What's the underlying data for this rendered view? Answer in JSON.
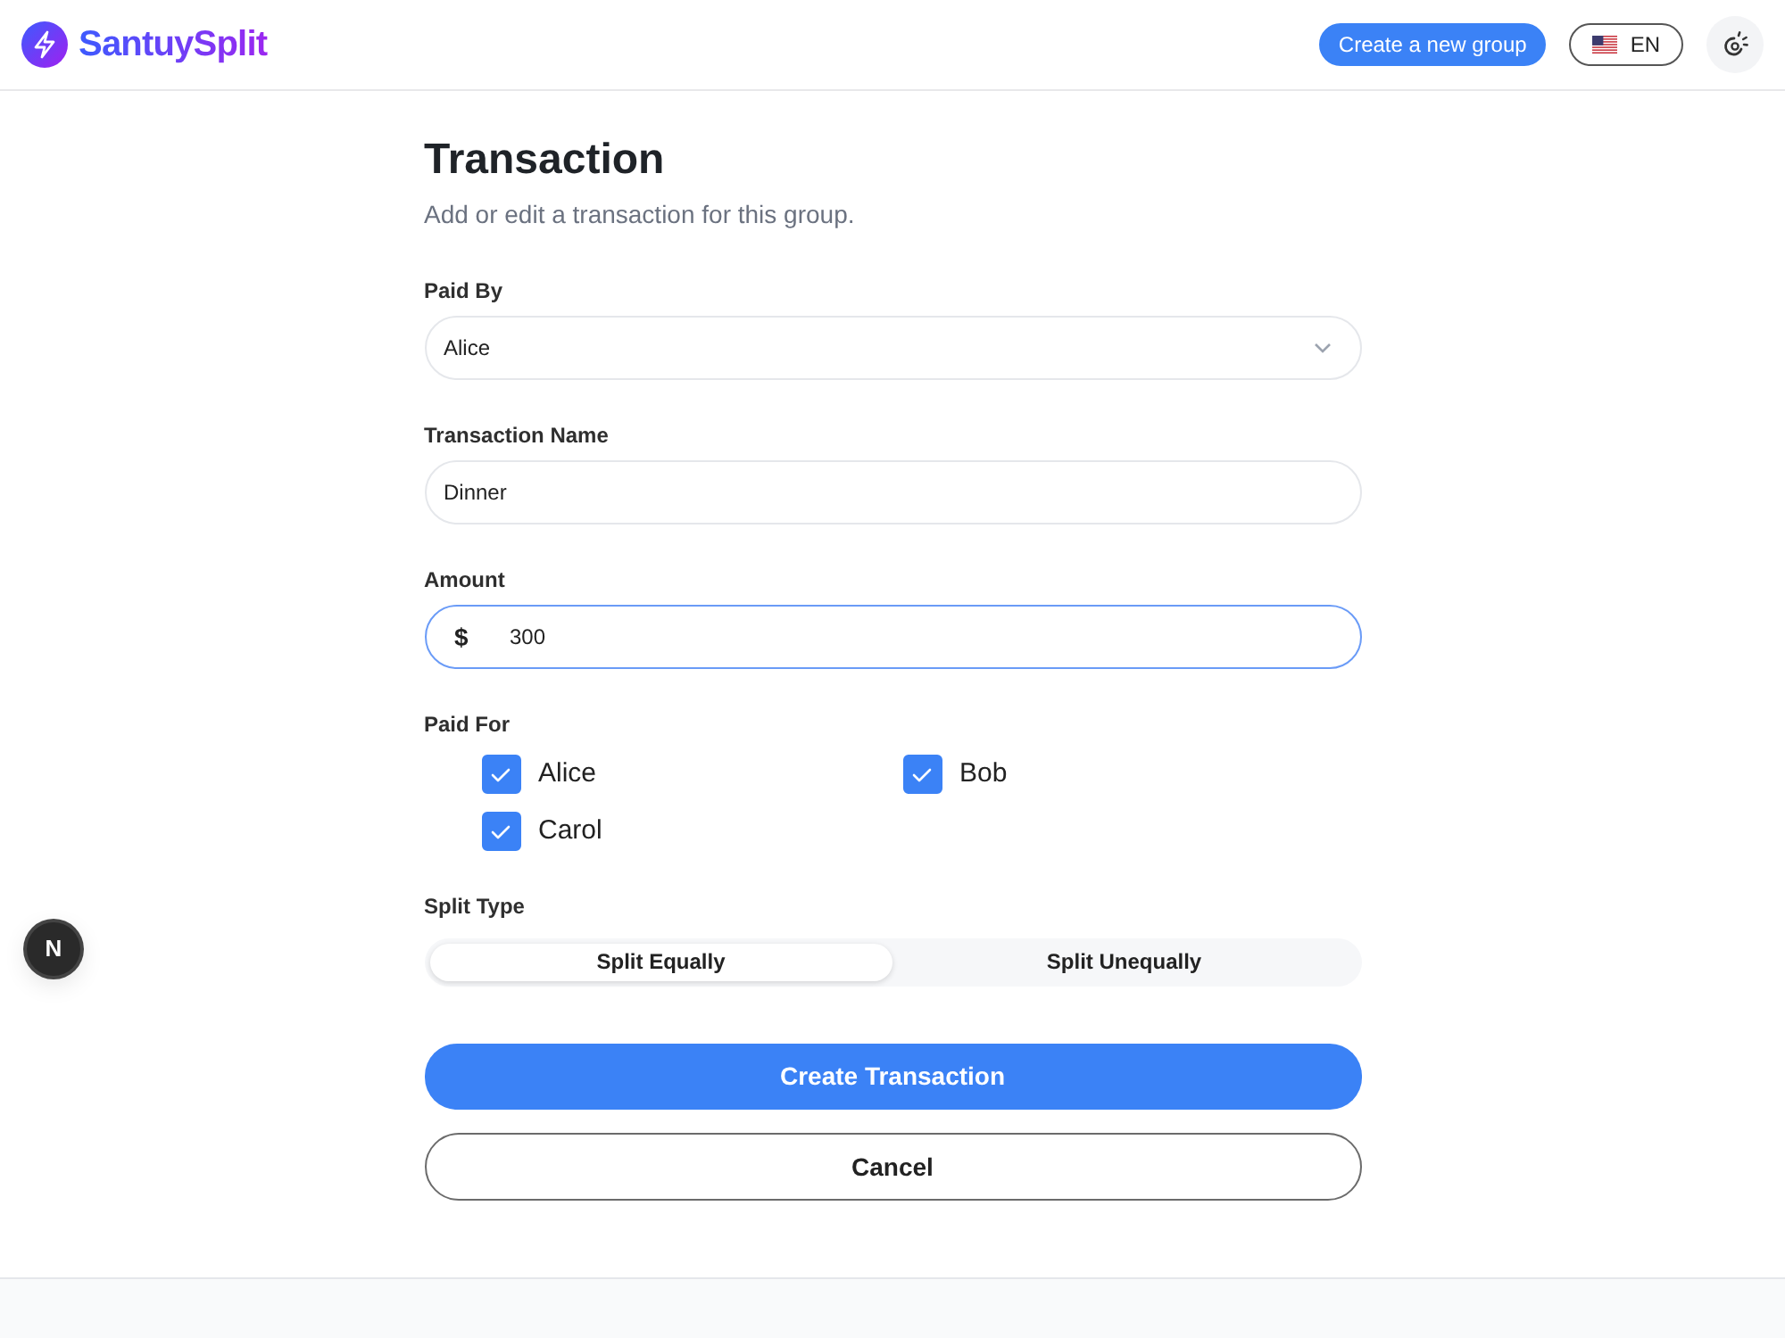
{
  "header": {
    "logo_text": "SantuySplit",
    "create_group_label": "Create a new group",
    "language_label": "EN"
  },
  "form": {
    "title": "Transaction",
    "subtitle": "Add or edit a transaction for this group.",
    "fields": [
      {
        "kind": "select",
        "label": "Paid By",
        "value": "Alice"
      },
      {
        "kind": "text",
        "label": "Transaction Name",
        "value": "Dinner"
      },
      {
        "kind": "amount",
        "label": "Amount",
        "prefix": "$",
        "value": "300",
        "focused": true
      }
    ],
    "paid_for": {
      "label": "Paid For",
      "members": [
        {
          "name": "Alice",
          "checked": true
        },
        {
          "name": "Bob",
          "checked": true
        },
        {
          "name": "Carol",
          "checked": true
        }
      ]
    },
    "split_type": {
      "label": "Split Type",
      "options": [
        {
          "label": "Split Equally",
          "selected": true
        },
        {
          "label": "Split Unequally",
          "selected": false
        }
      ]
    },
    "buttons": [
      {
        "kind": "primary",
        "label": "Create Transaction"
      },
      {
        "kind": "secondary",
        "label": "Cancel"
      }
    ]
  },
  "dev_badge": "N"
}
